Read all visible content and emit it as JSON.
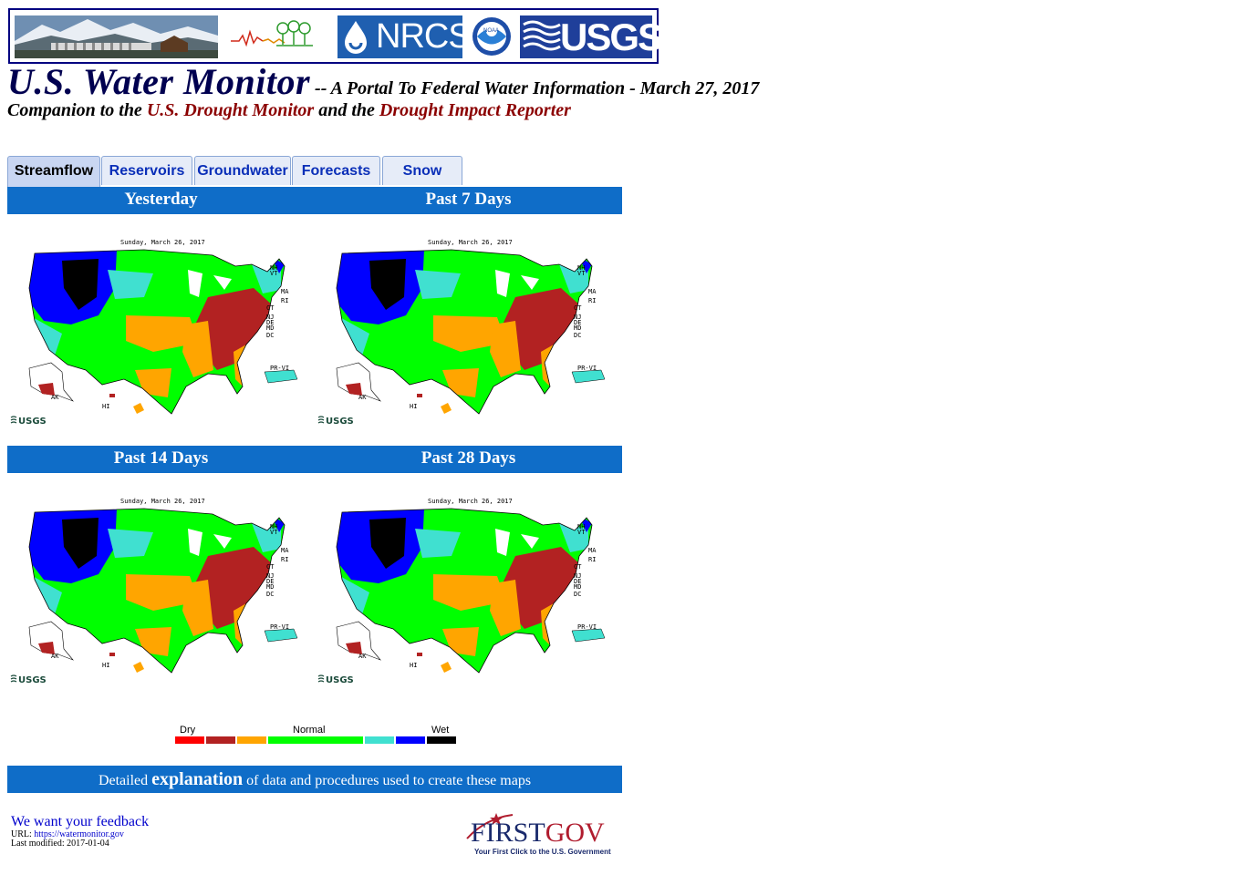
{
  "banner": {
    "nrcs_label": "NRCS",
    "noaa_label": "NOAA",
    "usgs_label": "USGS"
  },
  "title": {
    "main": "U.S. Water Monitor",
    "subtitle": " -- A Portal To Federal Water Information - March 27, 2017"
  },
  "companion": {
    "prefix": "Companion to the ",
    "link1": "U.S. Drought Monitor",
    "middle": " and the ",
    "link2": "Drought Impact Reporter"
  },
  "tabs": [
    {
      "label": "Streamflow",
      "active": true
    },
    {
      "label": "Reservoirs",
      "active": false
    },
    {
      "label": "Groundwater",
      "active": false
    },
    {
      "label": "Forecasts",
      "active": false
    },
    {
      "label": "Snow",
      "active": false
    }
  ],
  "sections": {
    "yesterday": "Yesterday",
    "past7": "Past 7 Days",
    "past14": "Past 14 Days",
    "past28": "Past 28 Days"
  },
  "map": {
    "date": "Sunday, March 26, 2017",
    "state_labels": [
      "NH",
      "VT",
      "MA",
      "RI",
      "CT",
      "NJ",
      "DE",
      "MD",
      "DC"
    ],
    "pr_label": "PR-VI",
    "ak_label": "AK",
    "hi_label": "HI",
    "usgs_label": "USGS"
  },
  "legend": {
    "dry": "Dry",
    "normal": "Normal",
    "wet": "Wet",
    "colors": [
      "#ff0000",
      "#b22222",
      "#ffa500",
      "#00ff00",
      "#40e0d0",
      "#0000ff",
      "#000000"
    ]
  },
  "explanation": {
    "prefix": "Detailed ",
    "bold": "explanation",
    "suffix": " of data and procedures used to create these maps"
  },
  "footer": {
    "feedback": "We want your feedback",
    "url_label": "URL: ",
    "url": "https://watermonitor.gov",
    "modified": "Last modified: 2017-01-04"
  },
  "firstgov": {
    "name_first": "FIRST",
    "name_gov": "GOV",
    "tagline": "Your First Click to the U.S. Government"
  }
}
